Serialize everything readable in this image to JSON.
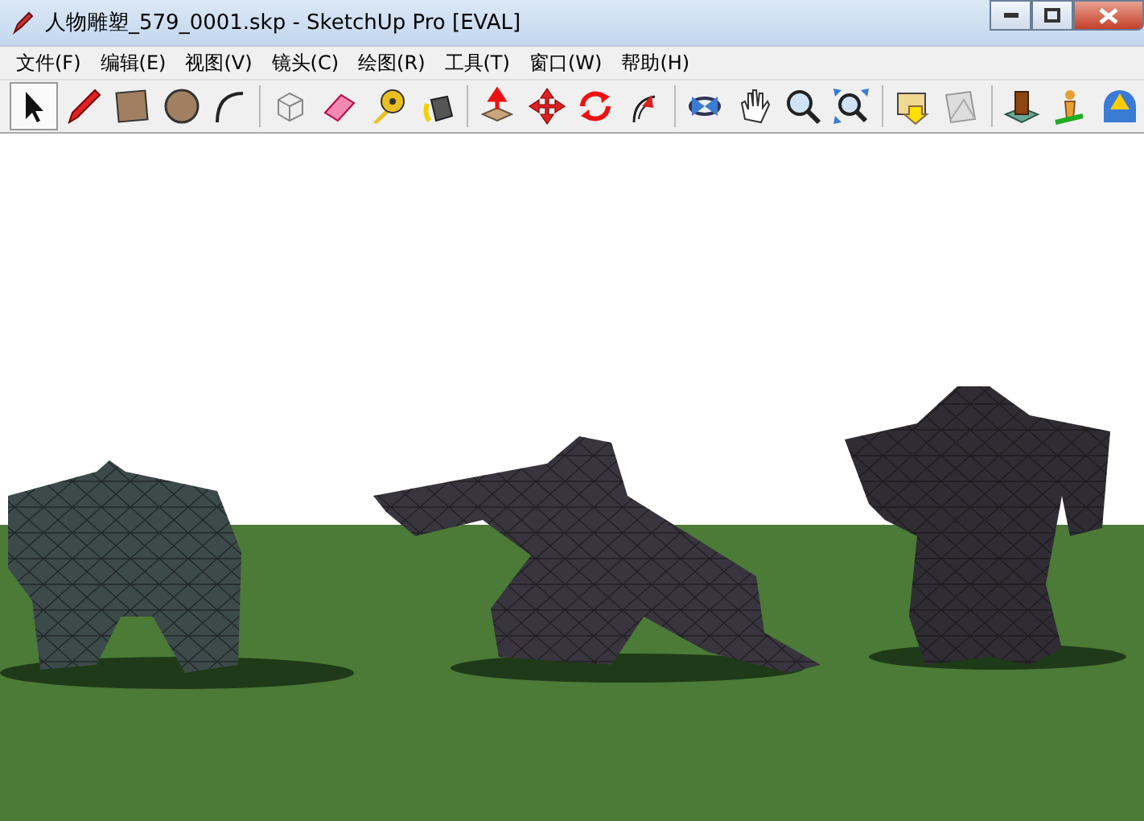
{
  "window": {
    "title": "人物雕塑_579_0001.skp - SketchUp Pro [EVAL]"
  },
  "menu": [
    "文件(F)",
    "编辑(E)",
    "视图(V)",
    "镜头(C)",
    "绘图(R)",
    "工具(T)",
    "窗口(W)",
    "帮助(H)"
  ],
  "toolbar": [
    {
      "kind": "select",
      "selected": true
    },
    {
      "kind": "pencil",
      "selected": false
    },
    {
      "kind": "rectangle",
      "selected": false
    },
    {
      "kind": "circle",
      "selected": false
    },
    {
      "kind": "arc",
      "selected": false
    },
    {
      "kind": "sep"
    },
    {
      "kind": "component",
      "selected": false
    },
    {
      "kind": "eraser",
      "selected": false
    },
    {
      "kind": "tape",
      "selected": false
    },
    {
      "kind": "paint",
      "selected": false
    },
    {
      "kind": "sep"
    },
    {
      "kind": "pushpull",
      "selected": false
    },
    {
      "kind": "move",
      "selected": false
    },
    {
      "kind": "rotate",
      "selected": false
    },
    {
      "kind": "followme",
      "selected": false
    },
    {
      "kind": "sep"
    },
    {
      "kind": "orbit",
      "selected": false
    },
    {
      "kind": "pan",
      "selected": false
    },
    {
      "kind": "zoom",
      "selected": false
    },
    {
      "kind": "extents",
      "selected": false
    },
    {
      "kind": "sep"
    },
    {
      "kind": "download",
      "selected": false
    },
    {
      "kind": "share",
      "selected": false
    },
    {
      "kind": "sep"
    },
    {
      "kind": "building",
      "selected": false
    },
    {
      "kind": "person",
      "selected": false
    },
    {
      "kind": "partial",
      "selected": false
    }
  ]
}
